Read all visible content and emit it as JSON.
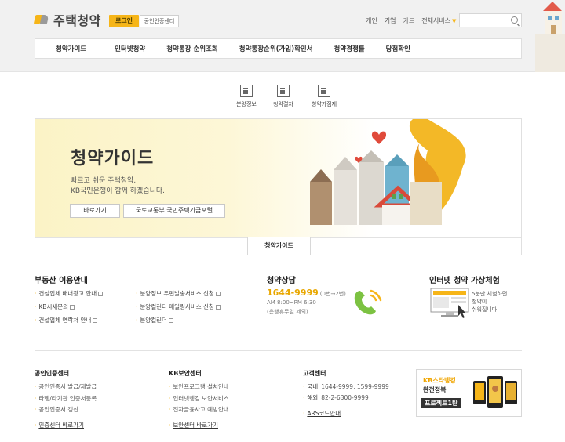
{
  "header": {
    "logo_text": "주택청약",
    "login_label": "로그인",
    "cert_label": "공인인증센터",
    "top_links": [
      "개인",
      "기업",
      "카드"
    ],
    "all_services": "전체서비스",
    "search_placeholder": ""
  },
  "gnb": {
    "items": [
      "청약가이드",
      "인터넷청약",
      "청약통장 순위조회",
      "청약통장순위(가입)확인서",
      "청약경쟁률",
      "당첨확인"
    ]
  },
  "quick_menu": [
    {
      "label": "분양정보",
      "icon": "document-icon"
    },
    {
      "label": "청약절차",
      "icon": "house-icon"
    },
    {
      "label": "청약가점제",
      "icon": "calculator-icon"
    }
  ],
  "hero": {
    "title": "청약가이드",
    "desc_line1": "빠르고 쉬운 주택청약,",
    "desc_line2": "KB국민은행이 함께 하겠습니다.",
    "btn_go": "바로가기",
    "btn_portal": "국토교통부 국민주택기금포털",
    "tab_label": "청약가이드"
  },
  "realty": {
    "title": "부동산 이용안내",
    "col1": [
      "건설업체 배너광고 안내",
      "KB시세문의",
      "건설업체 연락처 안내"
    ],
    "col2": [
      "분양정보 우편발송서비스 신청",
      "분양컬린더 메일링서비스 신청",
      "분양컬린더"
    ]
  },
  "consult": {
    "title": "청약상담",
    "phone": "1644-9999",
    "phone_ext": "(0번→2번)",
    "hours": "AM 8:00~PM 6:30",
    "holiday": "(은행휴무일 제외)"
  },
  "virtual": {
    "title": "인터넷 청약 가상체험",
    "text_lines": [
      "5분만 체험하면",
      "청약이",
      "쉬워집니다."
    ]
  },
  "footer": {
    "cert": {
      "title": "공인인증센터",
      "items": [
        "공인인증서 발급/재발급",
        "타행/타기관 인증서등록",
        "공인인증서 갱신"
      ],
      "link": "인증센터 바로가기"
    },
    "security": {
      "title": "KB보안센터",
      "items": [
        "보안프로그램 설치안내",
        "인터넷뱅킹 보안서비스",
        "전자금융사고 예방안내"
      ],
      "link": "보안센터 바로가기"
    },
    "customer": {
      "title": "고객센터",
      "domestic_label": "국내",
      "domestic": "1644-9999, 1599-9999",
      "overseas_label": "해외",
      "overseas": "82-2-6300-9999",
      "link": "ARS코드안내"
    },
    "banner": {
      "line1": "KB스타뱅킹",
      "line2": "완전정복",
      "line3": "프로젝트1탄"
    }
  },
  "colors": {
    "accent": "#f6b518",
    "phone": "#e8a700"
  }
}
